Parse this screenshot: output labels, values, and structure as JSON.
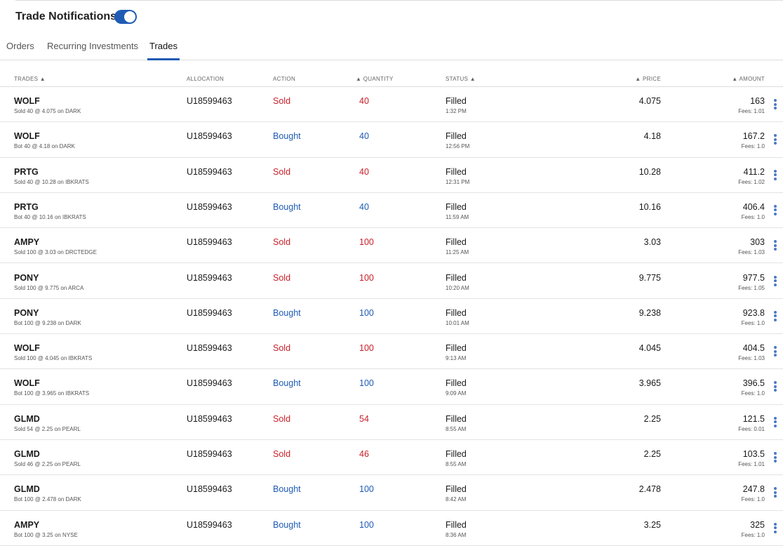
{
  "header": {
    "title": "Trade Notifications",
    "toggle_on": true
  },
  "tabs": [
    {
      "label": "Orders"
    },
    {
      "label": "Recurring Investments"
    },
    {
      "label": "Trades",
      "active": true
    }
  ],
  "columns": {
    "trades": "TRADES ▲",
    "allocation": "ALLOCATION",
    "action": "ACTION",
    "quantity": "▲ QUANTITY",
    "status": "STATUS ▲",
    "price": "▲ PRICE",
    "amount": "▲ AMOUNT"
  },
  "colors": {
    "sold": "#c8202a",
    "bought": "#1f5bb4",
    "accent": "#1f5bb4"
  },
  "rows": [
    {
      "symbol": "WOLF",
      "detail": "Sold 40 @ 4.075 on DARK",
      "allocation": "U18599463",
      "action": "Sold",
      "quantity": "40",
      "status": "Filled",
      "time": "1:32 PM",
      "price": "4.075",
      "amount": "163",
      "fees": "Fees: 1.01"
    },
    {
      "symbol": "WOLF",
      "detail": "Bot 40 @ 4.18 on DARK",
      "allocation": "U18599463",
      "action": "Bought",
      "quantity": "40",
      "status": "Filled",
      "time": "12:56 PM",
      "price": "4.18",
      "amount": "167.2",
      "fees": "Fees: 1.0"
    },
    {
      "symbol": "PRTG",
      "detail": "Sold 40 @ 10.28 on IBKRATS",
      "allocation": "U18599463",
      "action": "Sold",
      "quantity": "40",
      "status": "Filled",
      "time": "12:31 PM",
      "price": "10.28",
      "amount": "411.2",
      "fees": "Fees: 1.02"
    },
    {
      "symbol": "PRTG",
      "detail": "Bot 40 @ 10.16 on IBKRATS",
      "allocation": "U18599463",
      "action": "Bought",
      "quantity": "40",
      "status": "Filled",
      "time": "11:59 AM",
      "price": "10.16",
      "amount": "406.4",
      "fees": "Fees: 1.0"
    },
    {
      "symbol": "AMPY",
      "detail": "Sold 100 @ 3.03 on DRCTEDGE",
      "allocation": "U18599463",
      "action": "Sold",
      "quantity": "100",
      "status": "Filled",
      "time": "11:25 AM",
      "price": "3.03",
      "amount": "303",
      "fees": "Fees: 1.03"
    },
    {
      "symbol": "PONY",
      "detail": "Sold 100 @ 9.775 on ARCA",
      "allocation": "U18599463",
      "action": "Sold",
      "quantity": "100",
      "status": "Filled",
      "time": "10:20 AM",
      "price": "9.775",
      "amount": "977.5",
      "fees": "Fees: 1.05"
    },
    {
      "symbol": "PONY",
      "detail": "Bot 100 @ 9.238 on DARK",
      "allocation": "U18599463",
      "action": "Bought",
      "quantity": "100",
      "status": "Filled",
      "time": "10:01 AM",
      "price": "9.238",
      "amount": "923.8",
      "fees": "Fees: 1.0"
    },
    {
      "symbol": "WOLF",
      "detail": "Sold 100 @ 4.045 on IBKRATS",
      "allocation": "U18599463",
      "action": "Sold",
      "quantity": "100",
      "status": "Filled",
      "time": "9:13 AM",
      "price": "4.045",
      "amount": "404.5",
      "fees": "Fees: 1.03"
    },
    {
      "symbol": "WOLF",
      "detail": "Bot 100 @ 3.965 on IBKRATS",
      "allocation": "U18599463",
      "action": "Bought",
      "quantity": "100",
      "status": "Filled",
      "time": "9:09 AM",
      "price": "3.965",
      "amount": "396.5",
      "fees": "Fees: 1.0"
    },
    {
      "symbol": "GLMD",
      "detail": "Sold 54 @ 2.25 on PEARL",
      "allocation": "U18599463",
      "action": "Sold",
      "quantity": "54",
      "status": "Filled",
      "time": "8:55 AM",
      "price": "2.25",
      "amount": "121.5",
      "fees": "Fees: 0.01"
    },
    {
      "symbol": "GLMD",
      "detail": "Sold 46 @ 2.25 on PEARL",
      "allocation": "U18599463",
      "action": "Sold",
      "quantity": "46",
      "status": "Filled",
      "time": "8:55 AM",
      "price": "2.25",
      "amount": "103.5",
      "fees": "Fees: 1.01"
    },
    {
      "symbol": "GLMD",
      "detail": "Bot 100 @ 2.478 on DARK",
      "allocation": "U18599463",
      "action": "Bought",
      "quantity": "100",
      "status": "Filled",
      "time": "8:42 AM",
      "price": "2.478",
      "amount": "247.8",
      "fees": "Fees: 1.0"
    },
    {
      "symbol": "AMPY",
      "detail": "Bot 100 @ 3.25 on NYSE",
      "allocation": "U18599463",
      "action": "Bought",
      "quantity": "100",
      "status": "Filled",
      "time": "8:36 AM",
      "price": "3.25",
      "amount": "325",
      "fees": "Fees: 1.0"
    }
  ]
}
